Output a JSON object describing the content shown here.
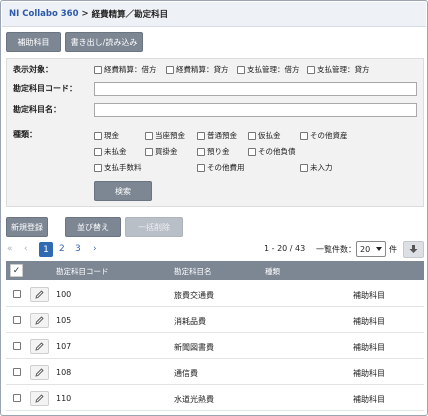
{
  "titlebar": {
    "app_name": "NI Collabo 360",
    "separator": ">",
    "breadcrumb": "経費精算／勘定科目"
  },
  "top_buttons": {
    "sub_account": "補助科目",
    "export_import": "書き出し/読み込み"
  },
  "search": {
    "display_target_label": "表示対象：",
    "display_target_options": [
      "経費精算：借方",
      "経費精算：貸方",
      "支払管理：借方",
      "支払管理：貸方"
    ],
    "account_code_label": "勘定科目コード：",
    "account_code_value": "",
    "account_name_label": "勘定科目名：",
    "account_name_value": "",
    "type_label": "種類：",
    "type_options": [
      "現金",
      "当座預金",
      "普通預金",
      "仮払金",
      "その他資産",
      "未払金",
      "買掛金",
      "預り金",
      "その他負債",
      "支払手数料",
      "その他費用",
      "未入力"
    ],
    "search_button": "検索"
  },
  "actions": {
    "new": "新規登録",
    "sort": "並び替え",
    "bulk_delete": "一括削除"
  },
  "pager": {
    "first": "«",
    "prev": "‹",
    "pages": [
      "1",
      "2",
      "3"
    ],
    "next": "›",
    "range": "1 - 20 / 43",
    "per_page_label": "一覧件数：",
    "per_page_value": "20",
    "per_page_unit": "件"
  },
  "table": {
    "headers": {
      "check": "✓",
      "code": "勘定科目コード",
      "name": "勘定科目名",
      "type": "種類"
    },
    "rows": [
      {
        "code": "100",
        "name": "旅費交通費",
        "type": "",
        "link": "補助科目"
      },
      {
        "code": "105",
        "name": "消耗品費",
        "type": "",
        "link": "補助科目"
      },
      {
        "code": "107",
        "name": "新聞図書費",
        "type": "",
        "link": "補助科目"
      },
      {
        "code": "108",
        "name": "通信費",
        "type": "",
        "link": "補助科目"
      },
      {
        "code": "110",
        "name": "水道光熱費",
        "type": "",
        "link": "補助科目"
      }
    ]
  },
  "icons": {
    "edit": "pencil-icon",
    "download": "download-icon",
    "dropdown": "chevron-down-icon"
  },
  "colors": {
    "brand": "#2e5aa8",
    "header_bg": "#7d8794",
    "link": "#2f5fb0",
    "current_page": "#2f6ab3"
  }
}
